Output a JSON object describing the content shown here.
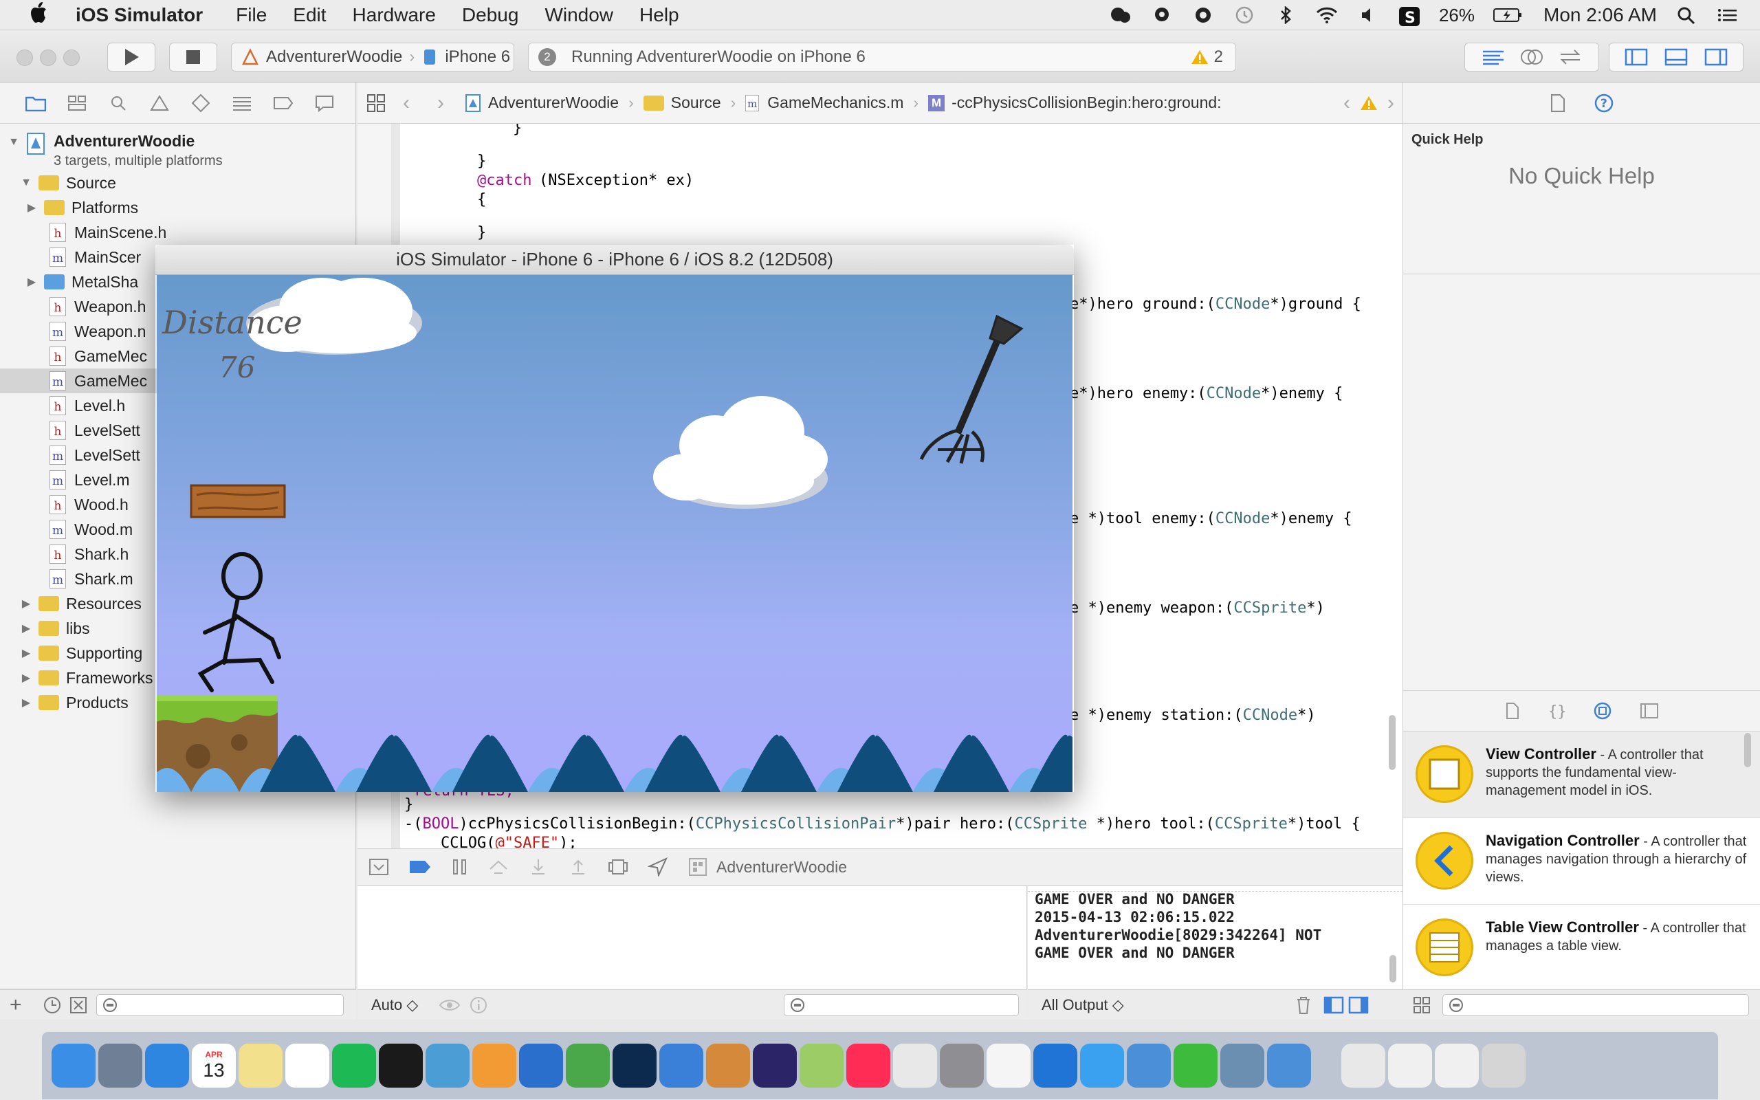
{
  "menubar": {
    "app_name": "iOS Simulator",
    "items": [
      "File",
      "Edit",
      "Hardware",
      "Debug",
      "Window",
      "Help"
    ],
    "battery": "26%",
    "clock": "Mon 2:06 AM"
  },
  "toolbar": {
    "scheme_name": "AdventurerWoodie",
    "device_name": "iPhone 6",
    "activity_count": "2",
    "activity_text": "Running AdventurerWoodie on iPhone 6",
    "warning_count": "2"
  },
  "navigator": {
    "project_name": "AdventurerWoodie",
    "project_subtitle": "3 targets, multiple platforms",
    "items": [
      {
        "label": "Source",
        "type": "folder"
      },
      {
        "label": "Platforms",
        "type": "folder"
      },
      {
        "label": "MainScene.h",
        "type": "h"
      },
      {
        "label": "MainScer",
        "type": "m"
      },
      {
        "label": "MetalSha",
        "type": "folder"
      },
      {
        "label": "Weapon.h",
        "type": "h"
      },
      {
        "label": "Weapon.n",
        "type": "m"
      },
      {
        "label": "GameMec",
        "type": "h"
      },
      {
        "label": "GameMec",
        "type": "m"
      },
      {
        "label": "Level.h",
        "type": "h"
      },
      {
        "label": "LevelSett",
        "type": "h"
      },
      {
        "label": "LevelSett",
        "type": "m"
      },
      {
        "label": "Level.m",
        "type": "m"
      },
      {
        "label": "Wood.h",
        "type": "h"
      },
      {
        "label": "Wood.m",
        "type": "m"
      },
      {
        "label": "Shark.h",
        "type": "h"
      },
      {
        "label": "Shark.m",
        "type": "m"
      },
      {
        "label": "Resources",
        "type": "folder"
      },
      {
        "label": "libs",
        "type": "folder"
      },
      {
        "label": "Supporting",
        "type": "folder"
      },
      {
        "label": "Frameworks",
        "type": "folder"
      },
      {
        "label": "Products",
        "type": "folder"
      }
    ]
  },
  "jumpbar": {
    "crumbs": [
      "AdventurerWoodie",
      "Source",
      "GameMechanics.m",
      "-ccPhysicsCollisionBegin:hero:ground:"
    ]
  },
  "editor": {
    "line_close1": "}",
    "line_close2": "}",
    "catch_kw": "@catch",
    "catch_rest": "(NSException* ex)",
    "line_open": "{",
    "line_close3": "}",
    "r1_a": "e*)hero ground:(",
    "r1_t": "CCNode",
    "r1_b": "*)ground {",
    "r2_a": "e*)hero enemy:(",
    "r2_t": "CCNode",
    "r2_b": "*)enemy {",
    "r3_a": "e *)tool enemy:(",
    "r3_t": "CCNode",
    "r3_b": "*)enemy {",
    "r4_a": "e *)enemy weapon:(",
    "r4_t": "CCSprite",
    "r4_b": "*)",
    "r5_a": "e *)enemy station:(",
    "r5_t": "CCNode",
    "r5_b": "*)",
    "ret_partial": "return YES;",
    "brace_close": "}",
    "sig_a": "-(",
    "sig_kw": "BOOL",
    "sig_b": ")ccPhysicsCollisionBegin:(",
    "sig_t1": "CCPhysicsCollisionPair",
    "sig_c": "*)pair hero:(",
    "sig_t2": "CCSprite",
    "sig_d": " *)hero tool:(",
    "sig_t3": "CCSprite",
    "sig_e": "*)tool {",
    "cclog_a": "    CCLOG(",
    "cclog_s": "@\"SAFE\"",
    "cclog_b": ");"
  },
  "debug": {
    "process_name": "AdventurerWoodie",
    "console_lines": [
      "GAME OVER and NO DANGER",
      "2015-04-13 02:06:15.022",
      "AdventurerWoodie[8029:342264] NOT",
      "GAME OVER and NO DANGER"
    ],
    "auto_label": "Auto ◇",
    "output_label": "All Output ◇"
  },
  "utilities": {
    "quick_help_title": "Quick Help",
    "no_quick_help": "No Quick Help",
    "library": [
      {
        "name": "View Controller",
        "desc": " - A controller that supports the fundamental view-management model in iOS."
      },
      {
        "name": "Navigation Controller",
        "desc": " - A controller that manages navigation through a hierarchy of views."
      },
      {
        "name": "Table View Controller",
        "desc": " - A controller that manages a table view."
      }
    ]
  },
  "simulator": {
    "title": "iOS Simulator - iPhone 6 - iPhone 6 / iOS 8.2 (12D508)",
    "distance_label": "Distance",
    "distance_value": "76"
  },
  "dock": {
    "calendar_month": "APR",
    "calendar_day": "13",
    "icons": [
      "finder-icon",
      "launchpad-icon",
      "safari-icon",
      "calendar-icon",
      "notes-icon",
      "reminders-icon",
      "spotify-icon",
      "terminal-icon",
      "preview-icon",
      "pages-icon",
      "word-icon",
      "evernote-icon",
      "photoshop-icon",
      "xcode-icon",
      "game-icon",
      "eclipse-icon",
      "android-studio-icon",
      "itunes-icon",
      "chrome-icon",
      "system-preferences-icon",
      "textedit-icon",
      "quicktime-icon",
      "messages-icon",
      "ios-simulator-icon",
      "wechat-icon",
      "image-capture-icon",
      "xcode-doc-icon",
      "documents-icon",
      "screenshot-icon",
      "screenshot2-icon",
      "trash-icon"
    ]
  }
}
